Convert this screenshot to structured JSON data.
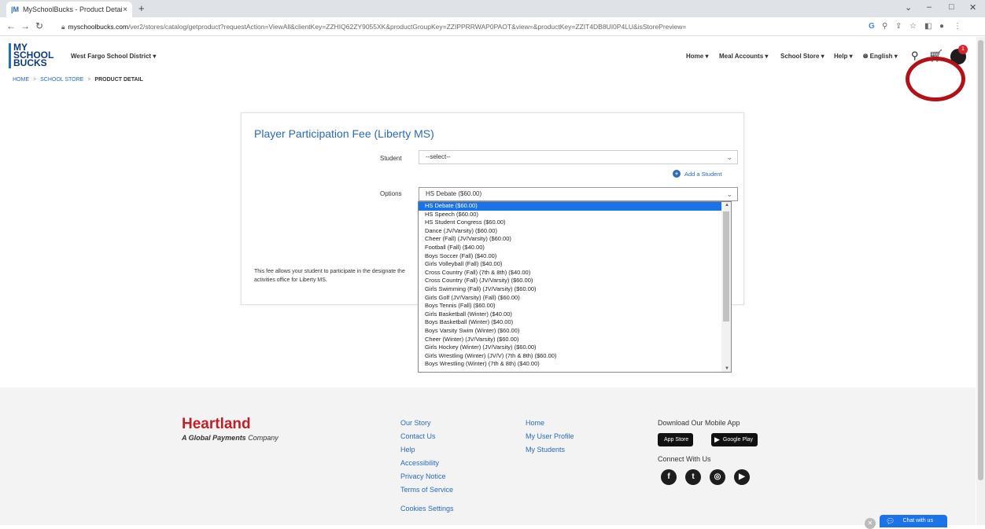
{
  "browser": {
    "tab_title": "MySchoolBucks - Product Detail",
    "tab_close": "×",
    "new_tab": "+",
    "url_host": "myschoolbucks.com",
    "url_path": "/ver2/stores/catalog/getproduct?requestAction=ViewAll&clientKey=ZZHIQ62ZY9055XK&productGroupKey=ZZIPPRRWAP0PAOT&view=&productKey=ZZIT4DB8UI0P4LU&isStorePreview="
  },
  "header": {
    "logo_lines": [
      "MY",
      "SCHOOL",
      "BUCKS"
    ],
    "district": "West Fargo School District",
    "nav": {
      "home": "Home",
      "meal_accounts": "Meal Accounts",
      "school_store": "School Store",
      "help": "Help",
      "language": "English"
    },
    "cart_count": "1"
  },
  "breadcrumb": {
    "home": "HOME",
    "school_store": "SCHOOL STORE",
    "current": "PRODUCT DETAIL",
    "separator": ">"
  },
  "product": {
    "title": "Player Participation Fee (Liberty MS)",
    "student_label": "Student",
    "student_value": "--select--",
    "add_student": "Add a Student",
    "options_label": "Options",
    "options_value": "HS Debate ($60.00)",
    "description": "This fee allows your student to participate in the designate the activities office for Liberty MS."
  },
  "options_list": [
    "HS Debate ($60.00)",
    "HS Speech ($60.00)",
    "HS Student Congress ($60.00)",
    "Dance (JV/Varsity) ($60.00)",
    "Cheer (Fall) (JV/Varsity) ($60.00)",
    "Football (Fall) ($40.00)",
    "Boys Soccer (Fall) ($40.00)",
    "Girls Volleyball (Fall) ($40.00)",
    "Cross Country (Fall) (7th & 8th) ($40.00)",
    "Cross Country (Fall) (JV/Varsity) ($60.00)",
    "Girls Swimming (Fall) (JV/Varsity) ($60.00)",
    "Girls Golf (JV/Varsity) (Fall) ($60.00)",
    "Boys Tennis (Fall) ($60.00)",
    "Girls Basketball (Winter) ($40.00)",
    "Boys Basketball (Winter) ($40.00)",
    "Boys Varsity Swim (Winter) ($60.00)",
    "Cheer (Winter) (JV/Varsity) ($60.00)",
    "Girls Hockey (Winter) (JV/Varsity) ($60.00)",
    "Girls Wrestling (Winter) (JV/V) (7th & 8th) ($60.00)",
    "Boys Wrestling (Winter) (7th & 8th) ($40.00)"
  ],
  "footer": {
    "brand_name": "Heartland",
    "brand_tag_bold": "A Global Payments",
    "brand_tag_rest": " Company",
    "col1": [
      "Our Story",
      "Contact Us",
      "Help",
      "Accessibility",
      "Privacy Notice",
      "Terms of Service",
      "Cookies Settings"
    ],
    "col2": [
      "Home",
      "My User Profile",
      "My Students"
    ],
    "download_title": "Download Our Mobile App",
    "app_store": "App Store",
    "google_play": "Google Play",
    "connect_title": "Connect With Us",
    "chat": "Chat with us"
  },
  "colors": {
    "brand_blue": "#2a6ab7",
    "heartland_red": "#c0202a",
    "annotation_ring": "#b01218",
    "selected_option": "#1a73e8"
  }
}
